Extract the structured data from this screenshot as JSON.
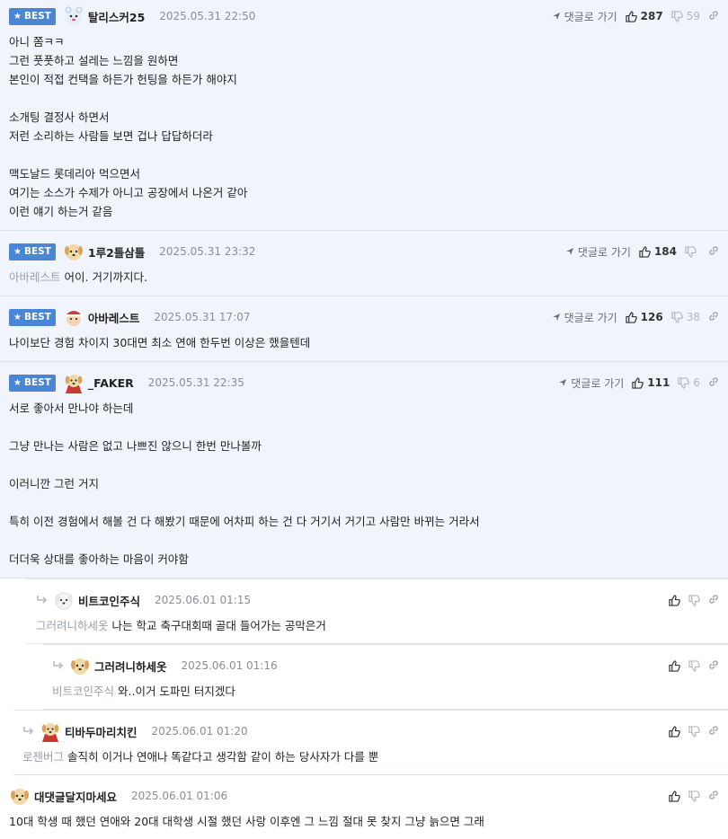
{
  "labels": {
    "best": "BEST",
    "reply_link": "댓글로 가기"
  },
  "colors": {
    "best_badge": "#4a86d6",
    "best_bg": "#f1f5fb"
  },
  "comments": [
    {
      "nick": "탈리스커25",
      "date": "2025.05.31 22:50",
      "up": "287",
      "down": "59",
      "lines": [
        "아니 쫌ㅋㅋ",
        "그런 풋풋하고 설레는 느낌을 원하면",
        "본인이 적접 컨택을 하든가 헌팅을 하든가 해야지",
        "",
        "소개팅 결정사 하면서",
        "저런 소리하는 사람들 보면 겁나 답답하더라",
        "",
        "맥도날드 롯데리아 먹으면서",
        "여기는 소스가 수제가 아니고 공장에서 나온거 같아",
        "이런 얘기 하는거 같음"
      ]
    },
    {
      "nick": "1루2틀삼틀",
      "date": "2025.05.31 23:32",
      "up": "184",
      "down": "",
      "mention": "아바레스트",
      "lines": [
        "어이. 거기까지다."
      ]
    },
    {
      "nick": "아바레스트",
      "date": "2025.05.31 17:07",
      "up": "126",
      "down": "38",
      "lines": [
        "나이보단 경험 차이지 30대면 최소 연애 한두번 이상은 했을텐데"
      ]
    },
    {
      "nick": "_FAKER",
      "date": "2025.05.31 22:35",
      "up": "111",
      "down": "6",
      "lines": [
        "서로 좋아서 만나야 하는데",
        "",
        "그냥 만나는 사람은 없고 나쁘진 않으니 한번 만나볼까",
        "",
        "이러니깐 그런 거지",
        "",
        "특히 이전 경험에서 해볼 건 다 해봤기 때문에 어차피 하는 건 다 거기서 거기고 사람만 바뀌는 거라서",
        "",
        "더더욱 상대를 좋아하는 마음이 커야함"
      ]
    }
  ],
  "replies": [
    {
      "nick": "비트코인주식",
      "date": "2025.06.01 01:15",
      "mention": "그러려니하세옷",
      "text": "나는 학교 축구대회때 골대 들어가는 공막은거"
    },
    {
      "nick": "그러려니하세옷",
      "date": "2025.06.01 01:16",
      "mention": "비트코인주식",
      "text": "와..이거 도파민 터지겠다"
    },
    {
      "nick": "티바두마리치킨",
      "date": "2025.06.01 01:20",
      "mention": "로젠버그",
      "text": "솔직히 이거나 연애나 똑같다고 생각함 같이 하는 당사자가 다를 뿐"
    }
  ],
  "last": {
    "nick": "대댓글달지마세요",
    "date": "2025.06.01 01:06",
    "text": "10대 학생 때 했던 연애와 20대 대학생 시절 했던 사랑 이후엔 그 느낌 절대 못 찾지 그냥 늙으면 그래"
  }
}
